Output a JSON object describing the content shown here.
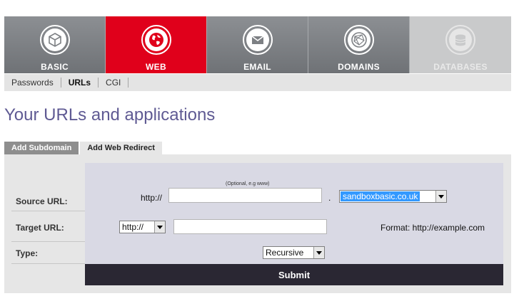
{
  "nav": {
    "items": [
      {
        "label": "BASIC",
        "icon": "cube-icon"
      },
      {
        "label": "WEB",
        "icon": "globe-icon"
      },
      {
        "label": "EMAIL",
        "icon": "envelope-icon"
      },
      {
        "label": "DOMAINS",
        "icon": "network-globe-icon"
      },
      {
        "label": "DATABASES",
        "icon": "database-icon"
      }
    ],
    "active": "WEB",
    "colors": {
      "active": "#e0001b",
      "default": "#7d8084",
      "disabled": "#c9cacb"
    }
  },
  "subnav": {
    "items": [
      "Passwords",
      "URLs",
      "CGI"
    ],
    "active": "URLs"
  },
  "page": {
    "title": "Your URLs and applications",
    "title_color": "#5f5a93"
  },
  "tabs": {
    "add_subdomain": "Add Subdomain",
    "add_web_redirect": "Add Web Redirect"
  },
  "form": {
    "source_label": "Source URL:",
    "target_label": "Target URL:",
    "type_label": "Type:",
    "hint": "(Optional, e.g www)",
    "source_prefix": "http://",
    "source_value": "",
    "dot": ".",
    "domain_select": "sandboxbasic.co.uk",
    "protocol_select": "http://",
    "target_value": "",
    "format_note": "Format: http://example.com",
    "type_select": "Recursive",
    "submit": "Submit"
  }
}
